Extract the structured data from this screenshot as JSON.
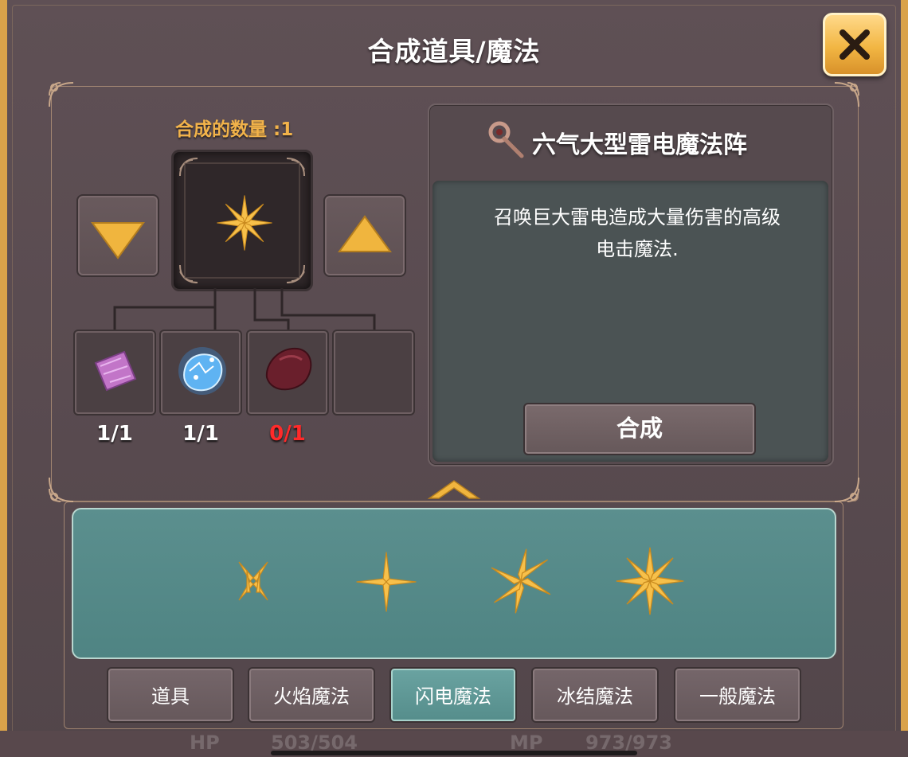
{
  "window": {
    "title": "合成道具/魔法"
  },
  "craft": {
    "quantity_label": "合成的数量 :1",
    "ingredients": [
      {
        "name": "purple-crystal",
        "count": "1/1",
        "count_color": "#ffffff"
      },
      {
        "name": "blue-energy-orb",
        "count": "1/1",
        "count_color": "#ffffff"
      },
      {
        "name": "dark-red-ore",
        "count": "0/1",
        "count_color": "#ff2a2a"
      },
      {
        "name": "empty",
        "count": ""
      }
    ]
  },
  "detail": {
    "title": "六气大型雷电魔法阵",
    "description_line1": "召唤巨大雷电造成大量伤害的高级",
    "description_line2": "电击魔法.",
    "craft_button": "合成"
  },
  "strip_items": [
    {
      "icon": "lightning-spark-small-icon"
    },
    {
      "icon": "lightning-cross-icon"
    },
    {
      "icon": "lightning-star-icon"
    },
    {
      "icon": "lightning-star-large-icon"
    }
  ],
  "tabs": [
    {
      "label": "道具",
      "active": false
    },
    {
      "label": "火焰魔法",
      "active": false
    },
    {
      "label": "闪电魔法",
      "active": true
    },
    {
      "label": "冰结魔法",
      "active": false
    },
    {
      "label": "一般魔法",
      "active": false
    }
  ],
  "hud": {
    "hp_label": "HP",
    "hp_value": "503/504",
    "mp_label": "MP",
    "mp_value": "973/973"
  },
  "colors": {
    "accent_gold": "#f2b34a",
    "teal": "#5b8f8e",
    "missing_red": "#ff2a2a"
  }
}
